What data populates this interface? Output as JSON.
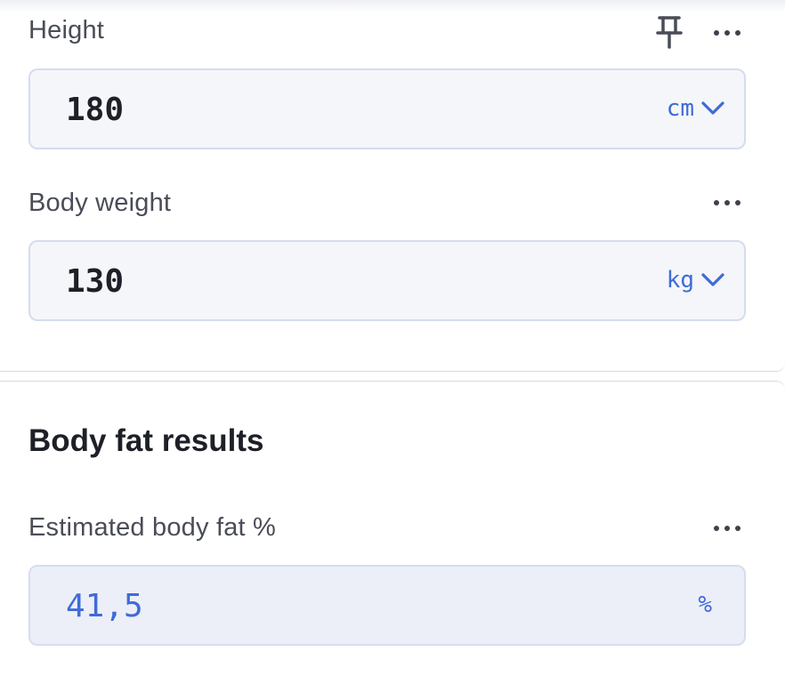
{
  "height": {
    "label": "Height",
    "value": "180",
    "unit": "cm",
    "icons": [
      "pin-icon",
      "more-icon"
    ]
  },
  "weight": {
    "label": "Body weight",
    "value": "130",
    "unit": "kg",
    "icons": [
      "more-icon"
    ]
  },
  "results": {
    "title": "Body fat results",
    "estimate": {
      "label": "Estimated body fat %",
      "value": "41,5",
      "unit": "%",
      "icons": [
        "more-icon"
      ]
    }
  },
  "colors": {
    "accent": "#3f6ad8",
    "field_bg": "#f5f6f9",
    "result_bg": "#eceff7",
    "text": "#1e2027",
    "label": "#4a4d57"
  }
}
